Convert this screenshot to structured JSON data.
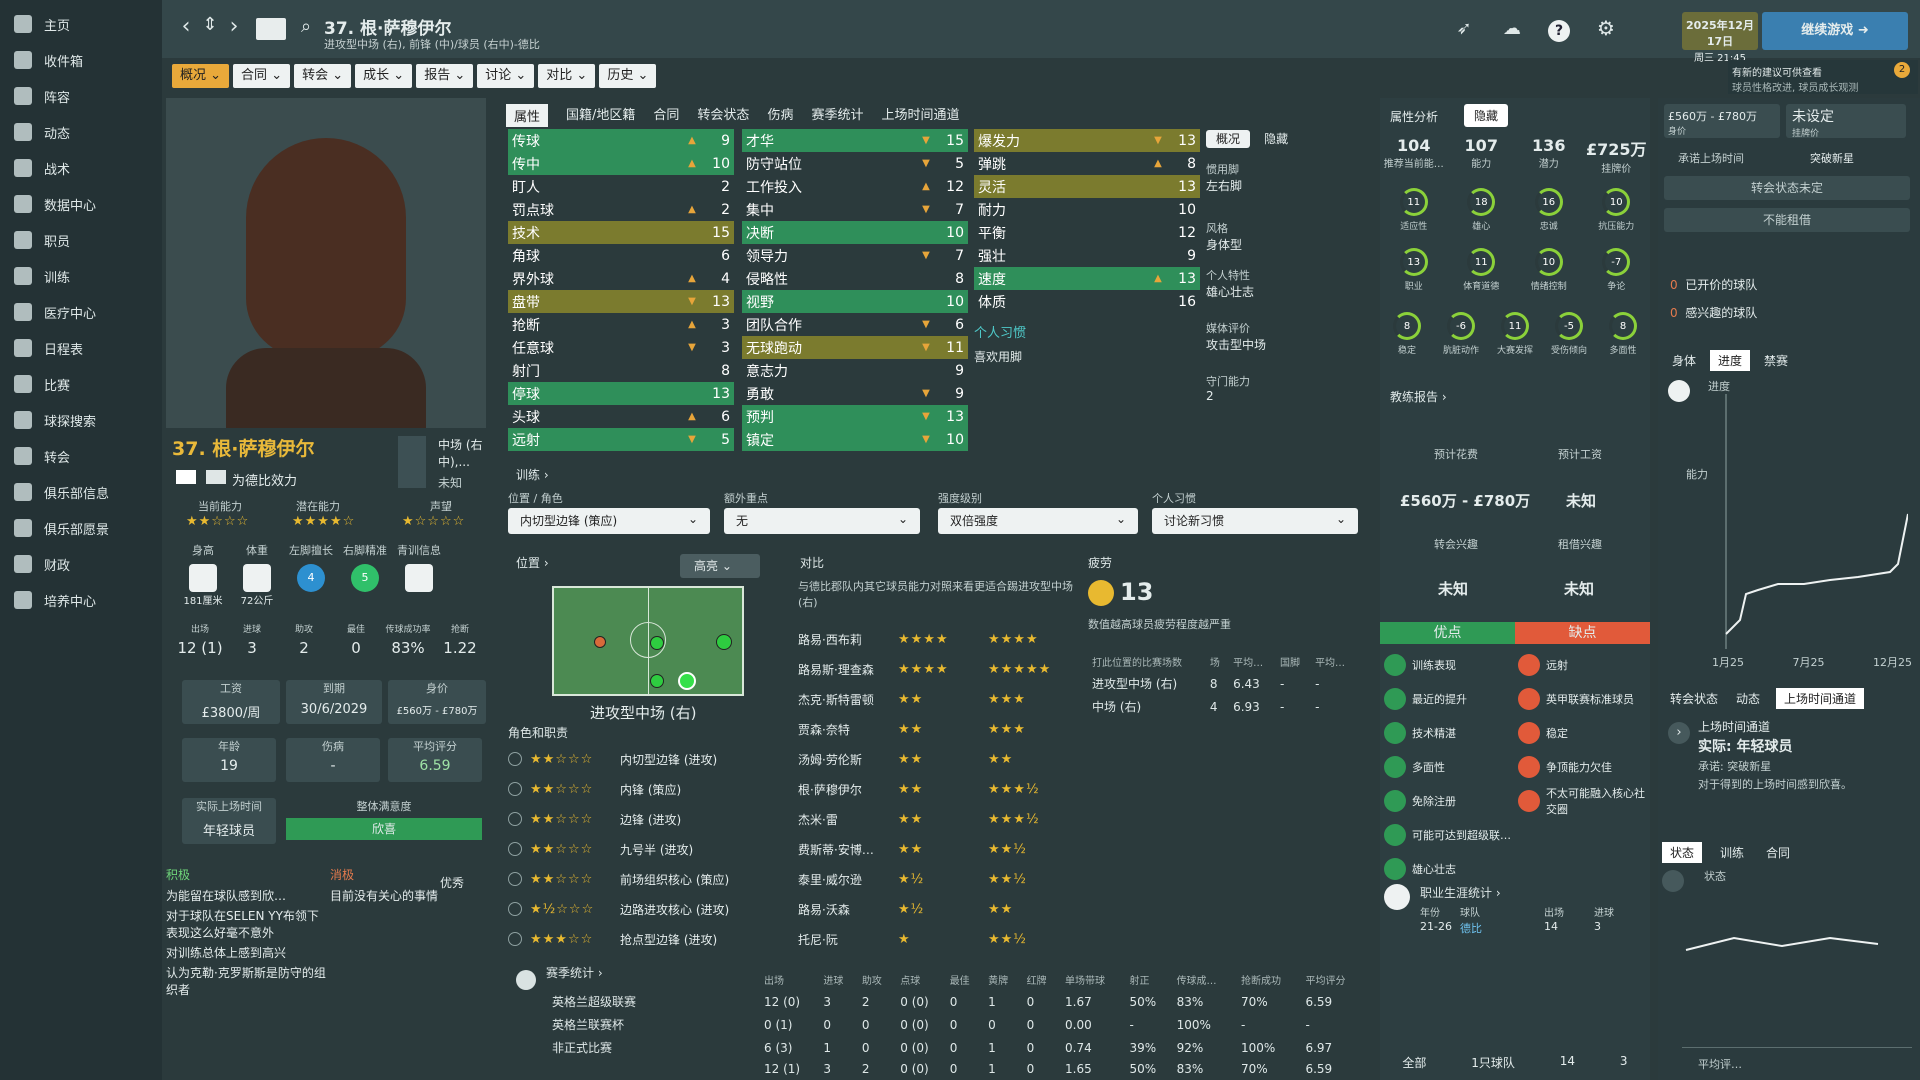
{
  "sidebar": {
    "items": [
      {
        "label": "主页",
        "icon": "home-icon"
      },
      {
        "label": "收件箱",
        "icon": "inbox-icon"
      },
      {
        "label": "阵容",
        "icon": "squad-icon"
      },
      {
        "label": "动态",
        "icon": "dynamics-icon"
      },
      {
        "label": "战术",
        "icon": "tactics-icon"
      },
      {
        "label": "数据中心",
        "icon": "data-hub-icon"
      },
      {
        "label": "职员",
        "icon": "staff-icon"
      },
      {
        "label": "训练",
        "icon": "training-icon"
      },
      {
        "label": "医疗中心",
        "icon": "medical-icon"
      },
      {
        "label": "日程表",
        "icon": "calendar-icon"
      },
      {
        "label": "比赛",
        "icon": "trophy-icon"
      },
      {
        "label": "球探搜索",
        "icon": "scouting-icon"
      },
      {
        "label": "转会",
        "icon": "transfer-icon"
      },
      {
        "label": "俱乐部信息",
        "icon": "shield-icon"
      },
      {
        "label": "俱乐部愿景",
        "icon": "vision-icon"
      },
      {
        "label": "财政",
        "icon": "finance-icon"
      },
      {
        "label": "培养中心",
        "icon": "development-icon"
      }
    ]
  },
  "header": {
    "player_title": "37. 根·萨穆伊尔",
    "player_sub": "进攻型中场 (右), 前锋 (中)/球员 (右中)-德比",
    "date": "2025年12月17日",
    "weekday_time": "周三 21:45",
    "continue": "继续游戏",
    "notice_title": "有新的建议可供查看",
    "notice_body": "球员性格改进, 球员成长观测",
    "notice_count": "2"
  },
  "tabs": [
    "概况",
    "合同",
    "转会",
    "成长",
    "报告",
    "讨论",
    "对比",
    "历史"
  ],
  "subtabs": [
    "属性",
    "国籍/地区籍",
    "合同",
    "转会状态",
    "伤病",
    "赛季统计",
    "上场时间通道"
  ],
  "attrs_col1": [
    {
      "n": "传球",
      "v": "9",
      "a": "▲",
      "h": "green"
    },
    {
      "n": "传中",
      "v": "10",
      "a": "▲",
      "h": "green"
    },
    {
      "n": "盯人",
      "v": "2",
      "a": "",
      "h": ""
    },
    {
      "n": "罚点球",
      "v": "2",
      "a": "▲",
      "h": ""
    },
    {
      "n": "技术",
      "v": "15",
      "a": "",
      "h": "olive"
    },
    {
      "n": "角球",
      "v": "6",
      "a": "",
      "h": ""
    },
    {
      "n": "界外球",
      "v": "4",
      "a": "▲",
      "h": ""
    },
    {
      "n": "盘带",
      "v": "13",
      "a": "▼",
      "h": "olive"
    },
    {
      "n": "抢断",
      "v": "3",
      "a": "▲",
      "h": ""
    },
    {
      "n": "任意球",
      "v": "3",
      "a": "▼",
      "h": ""
    },
    {
      "n": "射门",
      "v": "8",
      "a": "",
      "h": ""
    },
    {
      "n": "停球",
      "v": "13",
      "a": "",
      "h": "green"
    },
    {
      "n": "头球",
      "v": "6",
      "a": "▲",
      "h": ""
    },
    {
      "n": "远射",
      "v": "5",
      "a": "▼",
      "h": "green"
    }
  ],
  "attrs_col2": [
    {
      "n": "才华",
      "v": "15",
      "a": "▼",
      "h": "green"
    },
    {
      "n": "防守站位",
      "v": "5",
      "a": "▼",
      "h": ""
    },
    {
      "n": "工作投入",
      "v": "12",
      "a": "▲",
      "h": ""
    },
    {
      "n": "集中",
      "v": "7",
      "a": "▼",
      "h": ""
    },
    {
      "n": "决断",
      "v": "10",
      "a": "",
      "h": "green"
    },
    {
      "n": "领导力",
      "v": "7",
      "a": "▼",
      "h": ""
    },
    {
      "n": "侵略性",
      "v": "8",
      "a": "",
      "h": ""
    },
    {
      "n": "视野",
      "v": "10",
      "a": "",
      "h": "green"
    },
    {
      "n": "团队合作",
      "v": "6",
      "a": "▼",
      "h": ""
    },
    {
      "n": "无球跑动",
      "v": "11",
      "a": "▼",
      "h": "olive"
    },
    {
      "n": "意志力",
      "v": "9",
      "a": "",
      "h": ""
    },
    {
      "n": "勇敢",
      "v": "9",
      "a": "▼",
      "h": ""
    },
    {
      "n": "预判",
      "v": "13",
      "a": "▼",
      "h": "green"
    },
    {
      "n": "镇定",
      "v": "10",
      "a": "▼",
      "h": "green"
    }
  ],
  "attrs_col3": [
    {
      "n": "爆发力",
      "v": "13",
      "a": "▼",
      "h": "olive"
    },
    {
      "n": "弹跳",
      "v": "8",
      "a": "▲",
      "h": ""
    },
    {
      "n": "灵活",
      "v": "13",
      "a": "",
      "h": "olive"
    },
    {
      "n": "耐力",
      "v": "10",
      "a": "",
      "h": ""
    },
    {
      "n": "平衡",
      "v": "12",
      "a": "",
      "h": ""
    },
    {
      "n": "强壮",
      "v": "9",
      "a": "",
      "h": ""
    },
    {
      "n": "速度",
      "v": "13",
      "a": "▲",
      "h": "green"
    },
    {
      "n": "体质",
      "v": "16",
      "a": "",
      "h": ""
    }
  ],
  "personal": {
    "habits_title": "个人习惯",
    "habit": "喜欢用脚"
  },
  "side_info": {
    "tab1": "概况",
    "tab2": "隐藏",
    "foot_label": "惯用脚",
    "foot": "左右脚",
    "style_label": "风格",
    "body": "身体型",
    "trait_label": "个人特性",
    "trait": "雄心壮志",
    "media_label": "媒体评价",
    "media": "攻击型中场",
    "def_label": "守门能力",
    "def": "2"
  },
  "profile": {
    "name": "37. 根·萨穆伊尔",
    "club": "为德比效力",
    "pos": "中场 (右中),...",
    "pos2": "未知",
    "ca_label": "当前能力",
    "pa_label": "潜在能力",
    "rep_label": "声望",
    "ca_stars": "★★☆☆☆",
    "pa_stars": "★★★★☆",
    "rep_stars": "★☆☆☆☆",
    "height_label": "身高",
    "height": "181厘米",
    "weight_label": "体重",
    "weight": "72公斤",
    "lf_label": "左脚擅长",
    "lf": "4",
    "rf_label": "右脚精准",
    "rf": "5",
    "youth_label": "青训信息",
    "apps_label": "出场",
    "apps": "12 (1)",
    "goals_label": "进球",
    "goals": "3",
    "assists_label": "助攻",
    "assists": "2",
    "mom_label": "最佳",
    "mom": "0",
    "pass_label": "传球成功率",
    "pass": "83%",
    "tackle_label": "抢断",
    "tackle": "1.22",
    "wage_label": "工资",
    "wage": "£3800/周",
    "expiry_label": "到期",
    "expiry": "30/6/2029",
    "value_label": "身价",
    "value": "£560万 - £780万",
    "age_label": "年龄",
    "age": "19",
    "injury_label": "伤病",
    "injury": "-",
    "avg_label": "平均评分",
    "avg": "6.59",
    "playtime_label": "实际上场时间",
    "playtime": "年轻球员",
    "morale_label": "整体满意度",
    "morale": "欣喜"
  },
  "pros_cons": {
    "pos_title": "积极",
    "pos": [
      "为能留在球队感到欣…",
      "对于球队在SELEN YY布领下表现这么好毫不意外",
      "对训练总体上感到高兴",
      "认为克勒·克罗斯斯是防守的组织者"
    ],
    "neg_title": "消极",
    "neg": [
      "目前没有关心的事情"
    ],
    "badge": "优秀"
  },
  "training": {
    "title": "训练",
    "pos_label": "位置 / 角色",
    "pos_val": "内切型边锋 (策应)",
    "extra_label": "额外重点",
    "extra_val": "无",
    "intensity_label": "强度级别",
    "intensity_val": "双倍强度",
    "habit_label": "个人习惯",
    "habit_val": "讨论新习惯"
  },
  "position": {
    "title": "位置",
    "ability": "高亮",
    "role": "进攻型中场 (右)",
    "roles_title": "角色和职责",
    "roles": [
      {
        "s": "★★☆☆☆",
        "n": "内切型边锋 (进攻)"
      },
      {
        "s": "★★☆☆☆",
        "n": "内锋 (策应)"
      },
      {
        "s": "★★☆☆☆",
        "n": "边锋 (进攻)"
      },
      {
        "s": "★★☆☆☆",
        "n": "九号半 (进攻)"
      },
      {
        "s": "★★☆☆☆",
        "n": "前场组织核心 (策应)"
      },
      {
        "s": "★½☆☆☆",
        "n": "边路进攻核心 (进攻)"
      },
      {
        "s": "★★★☆☆",
        "n": "抢点型边锋 (进攻)"
      }
    ]
  },
  "compare": {
    "title": "对比",
    "desc": "与德比郡队内其它球员能力对照来看更适合踢进攻型中场 (右)",
    "rows": [
      {
        "n": "路易·西布莉",
        "a": "★★★★",
        "b": "★★★★"
      },
      {
        "n": "路易斯·理查森",
        "a": "★★★★",
        "b": "★★★★★"
      },
      {
        "n": "杰克·斯特雷顿",
        "a": "★★",
        "b": "★★★"
      },
      {
        "n": "贾森·奈特",
        "a": "★★",
        "b": "★★★"
      },
      {
        "n": "汤姆·劳伦斯",
        "a": "★★",
        "b": "★★"
      },
      {
        "n": "根·萨穆伊尔",
        "a": "★★",
        "b": "★★★½"
      },
      {
        "n": "杰米·雷",
        "a": "★★",
        "b": "★★★½"
      },
      {
        "n": "费斯蒂·安博…",
        "a": "★★",
        "b": "★★½"
      },
      {
        "n": "泰里·威尔逊",
        "a": "★½",
        "b": "★★½"
      },
      {
        "n": "路易·沃森",
        "a": "★½",
        "b": "★★"
      },
      {
        "n": "托尼·阮",
        "a": "★",
        "b": "★★½"
      }
    ]
  },
  "fatigue": {
    "title": "疲劳",
    "value": "13",
    "desc": "数值越高球员疲劳程度越严重",
    "table_head": [
      "打此位置的比赛场数",
      "场",
      "平均…",
      "国脚",
      "平均…"
    ],
    "rows": [
      [
        "进攻型中场 (右)",
        "8",
        "6.43",
        "-",
        "-"
      ],
      [
        "中场 (右)",
        "4",
        "6.93",
        "-",
        "-"
      ]
    ]
  },
  "season": {
    "title": "赛季统计",
    "head": [
      "出场",
      "进球",
      "助攻",
      "点球",
      "最佳",
      "黄牌",
      "红牌",
      "单场带球",
      "射正",
      "传球成…",
      "抢断成功",
      "平均评分"
    ],
    "rows": [
      {
        "comp": "英格兰超级联赛",
        "vals": [
          "12 (0)",
          "3",
          "2",
          "0 (0)",
          "0",
          "1",
          "0",
          "1.67",
          "50%",
          "83%",
          "70%",
          "6.59"
        ]
      },
      {
        "comp": "英格兰联赛杯",
        "vals": [
          "0 (1)",
          "0",
          "0",
          "0 (0)",
          "0",
          "0",
          "0",
          "0.00",
          "-",
          "100%",
          "-",
          "-"
        ]
      },
      {
        "comp": "非正式比赛",
        "vals": [
          "6 (3)",
          "1",
          "0",
          "0 (0)",
          "0",
          "1",
          "0",
          "0.74",
          "39%",
          "92%",
          "100%",
          "6.97"
        ]
      },
      {
        "comp": "",
        "vals": [
          "12 (1)",
          "3",
          "2",
          "0 (0)",
          "0",
          "1",
          "0",
          "1.65",
          "50%",
          "83%",
          "70%",
          "6.59"
        ]
      }
    ]
  },
  "analysis": {
    "tab1": "属性分析",
    "tab2": "隐藏",
    "stats": [
      {
        "v": "104",
        "l": "推荐当前能…"
      },
      {
        "v": "107",
        "l": "能力"
      },
      {
        "v": "136",
        "l": "潜力"
      },
      {
        "v": "£725万",
        "l": "挂牌价"
      }
    ],
    "gauges1": [
      {
        "v": "11",
        "l": "适应性"
      },
      {
        "v": "18",
        "l": "雄心"
      },
      {
        "v": "16",
        "l": "忠诚"
      },
      {
        "v": "10",
        "l": "抗压能力"
      }
    ],
    "gauges2": [
      {
        "v": "13",
        "l": "职业"
      },
      {
        "v": "11",
        "l": "体育道德"
      },
      {
        "v": "10",
        "l": "情绪控制"
      },
      {
        "v": "-7",
        "l": "争论"
      }
    ],
    "gauges3": [
      {
        "v": "8",
        "l": "稳定"
      },
      {
        "v": "-6",
        "l": "肮脏动作"
      },
      {
        "v": "11",
        "l": "大赛发挥"
      },
      {
        "v": "-5",
        "l": "受伤倾向"
      },
      {
        "v": "8",
        "l": "多面性"
      }
    ],
    "report_title": "教练报告",
    "cost_label": "预计花费",
    "cost": "£560万 - £780万",
    "wage_label": "预计工资",
    "wage": "未知",
    "ti_label": "转会兴趣",
    "ti": "未知",
    "li_label": "租借兴趣",
    "li": "未知",
    "pros": "优点",
    "cons": "缺点",
    "pro_list": [
      "训练表现",
      "最近的提升",
      "技术精湛",
      "多面性",
      "免除注册",
      "可能可达到超级联…",
      "雄心壮志"
    ],
    "con_list": [
      "远射",
      "英甲联赛标准球员",
      "稳定",
      "争顶能力欠佳",
      "不太可能融入核心社交圈"
    ],
    "career_title": "职业生涯统计",
    "career_head": [
      "年份",
      "球队",
      "出场",
      "进球"
    ],
    "career_row": [
      "21-26",
      "德比",
      "14",
      "3"
    ],
    "career_total": [
      "全部",
      "1只球队",
      "14",
      "3"
    ]
  },
  "right": {
    "price": "£560万 - £780万",
    "price_label": "身价",
    "unset": "未设定",
    "unset_label": "挂牌价",
    "promise": "承诺上场时间",
    "breakthrough": "突破新星",
    "status_undecided": "转会状态未定",
    "no_loan": "不能租借",
    "clubs_offered": "已开价的球队",
    "clubs_offered_n": "0",
    "clubs_interest": "感兴趣的球队",
    "clubs_interest_n": "0",
    "tabs": [
      "身体",
      "进度",
      "禁赛"
    ],
    "progress_title": "进度",
    "ability": "能力",
    "xticks": [
      "1月25",
      "7月25",
      "12月25"
    ],
    "tabs2": [
      "转会状态",
      "动态",
      "上场时间通道"
    ],
    "pt_title": "上场时间通道",
    "pt_actual": "实际: 年轻球员",
    "pt_promise": "承诺: 突破新星",
    "pt_desc": "对于得到的上场时间感到欣喜。",
    "tabs3": [
      "状态",
      "训练",
      "合同"
    ],
    "state_title": "状态",
    "avg_label": "平均评…"
  }
}
